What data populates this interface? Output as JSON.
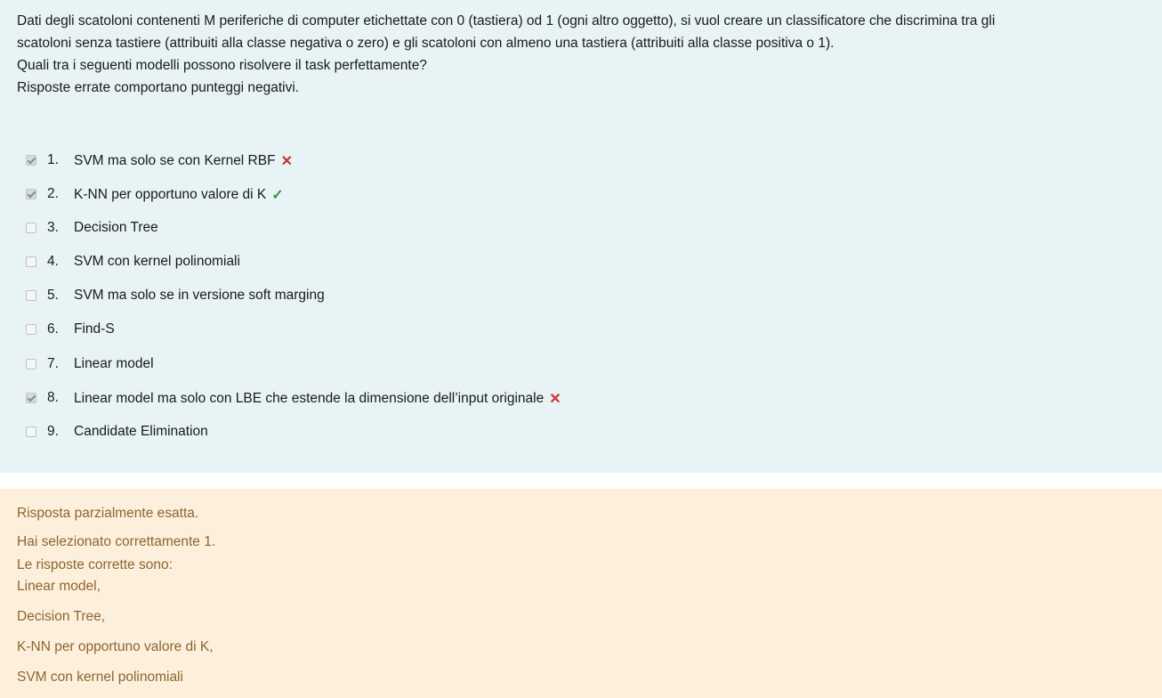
{
  "question": {
    "lines": [
      "Dati degli scatoloni  contenenti M periferiche di computer etichettate con 0 (tastiera)  od 1 (ogni altro oggetto), si vuol creare un classificatore che discrimina tra gli",
      "scatoloni senza tastiere  (attribuiti alla classe negativa o zero) e gli scatoloni con almeno una tastiera (attribuiti alla classe positiva o 1).",
      "Quali tra i seguenti modelli possono risolvere il task perfettamente?",
      "Risposte errate comportano punteggi negativi."
    ]
  },
  "answers": [
    {
      "num": "1.",
      "label": "SVM ma solo se con Kernel RBF",
      "checked": true,
      "mark": "✕",
      "mark_type": "wrong"
    },
    {
      "num": "2.",
      "label": "K-NN per opportuno valore di  K",
      "checked": true,
      "mark": "✓",
      "mark_type": "right"
    },
    {
      "num": "3.",
      "label": "Decision Tree",
      "checked": false,
      "mark": "",
      "mark_type": ""
    },
    {
      "num": "4.",
      "label": "SVM con kernel polinomiali",
      "checked": false,
      "mark": "",
      "mark_type": ""
    },
    {
      "num": "5.",
      "label": "SVM ma solo se in versione soft marging",
      "checked": false,
      "mark": "",
      "mark_type": ""
    },
    {
      "num": "6.",
      "label": "Find-S",
      "checked": false,
      "mark": "",
      "mark_type": ""
    },
    {
      "num": "7.",
      "label": "Linear model",
      "checked": false,
      "mark": "",
      "mark_type": ""
    },
    {
      "num": "8.",
      "label": "Linear model ma solo con LBE che estende la dimensione dell’input originale",
      "checked": true,
      "mark": "✕",
      "mark_type": "wrong"
    },
    {
      "num": "9.",
      "label": "Candidate Elimination",
      "checked": false,
      "mark": "",
      "mark_type": ""
    }
  ],
  "feedback": {
    "status": "Risposta parzialmente esatta.",
    "selected": "Hai selezionato correttamente 1.",
    "correct_header": "Le risposte corrette sono:",
    "correct_items": [
      "Linear model,",
      "Decision Tree,",
      "K-NN per opportuno valore di  K,",
      "SVM con kernel polinomiali"
    ]
  },
  "colors": {
    "question_bg": "#e7f3f5",
    "feedback_bg": "#fcefdc",
    "feedback_text": "#8e662e",
    "wrong_mark": "#d0312d",
    "right_mark": "#3f8f3f"
  }
}
